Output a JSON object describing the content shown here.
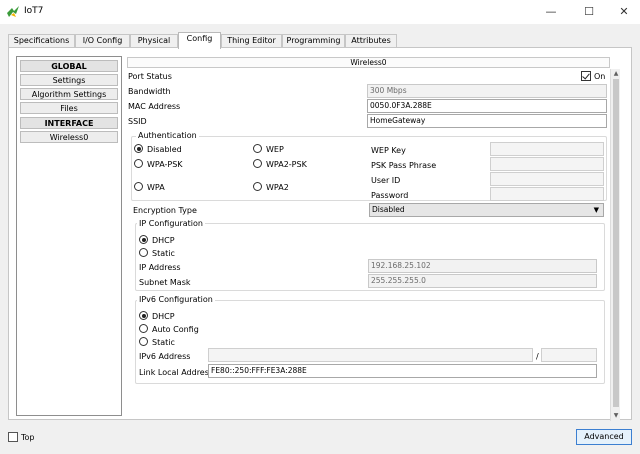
{
  "window": {
    "title": "IoT7",
    "icon": "packet-tracer-app-icon",
    "controls": {
      "minimize": "—",
      "maximize": "☐",
      "close": "✕"
    }
  },
  "tabs": [
    {
      "label": "Specifications",
      "active": false
    },
    {
      "label": "I/O Config",
      "active": false
    },
    {
      "label": "Physical",
      "active": false
    },
    {
      "label": "Config",
      "active": true
    },
    {
      "label": "Thing Editor",
      "active": false
    },
    {
      "label": "Programming",
      "active": false
    },
    {
      "label": "Attributes",
      "active": false
    }
  ],
  "sidebar": {
    "items": [
      {
        "label": "GLOBAL",
        "header": true
      },
      {
        "label": "Settings",
        "header": false
      },
      {
        "label": "Algorithm Settings",
        "header": false
      },
      {
        "label": "Files",
        "header": false
      },
      {
        "label": "INTERFACE",
        "header": true
      },
      {
        "label": "Wireless0",
        "header": false
      }
    ]
  },
  "wireless": {
    "title": "Wireless0",
    "port_status": {
      "label": "Port Status",
      "checkbox_label": "On",
      "checked": true
    },
    "bandwidth": {
      "label": "Bandwidth",
      "value": "300 Mbps"
    },
    "mac": {
      "label": "MAC Address",
      "value": "0050.0F3A.288E"
    },
    "ssid": {
      "label": "SSID",
      "value": "HomeGateway"
    }
  },
  "auth": {
    "legend": "Authentication",
    "options": {
      "disabled": "Disabled",
      "wep": "WEP",
      "wpa_psk": "WPA-PSK",
      "wpa2_psk": "WPA2-PSK",
      "wpa": "WPA",
      "wpa2": "WPA2"
    },
    "selected": "Disabled",
    "wep_key": {
      "label": "WEP Key",
      "value": ""
    },
    "psk_phrase": {
      "label": "PSK Pass Phrase",
      "value": ""
    },
    "user_id": {
      "label": "User ID",
      "value": ""
    },
    "password": {
      "label": "Password",
      "value": ""
    }
  },
  "encryption": {
    "label": "Encryption Type",
    "value": "Disabled",
    "arrow": "▼"
  },
  "ipv4": {
    "legend": "IP Configuration",
    "dhcp": "DHCP",
    "static": "Static",
    "selected": "DHCP",
    "ip": {
      "label": "IP Address",
      "value": "192.168.25.102"
    },
    "mask": {
      "label": "Subnet Mask",
      "value": "255.255.255.0"
    }
  },
  "ipv6": {
    "legend": "IPv6 Configuration",
    "dhcp": "DHCP",
    "auto": "Auto Config",
    "static": "Static",
    "selected": "DHCP",
    "address": {
      "label": "IPv6 Address",
      "value": "",
      "separator": "/",
      "prefix": ""
    },
    "link_local": {
      "label": "Link Local Address:",
      "value": "FE80::250:FFF:FE3A:288E"
    }
  },
  "bottom": {
    "top_label": "Top",
    "top_checked": false,
    "advanced_label": "Advanced"
  },
  "colors": {
    "accent": "#3c7fd1",
    "panel_border": "#c6c6c6",
    "field_border": "#a8a8a8"
  }
}
